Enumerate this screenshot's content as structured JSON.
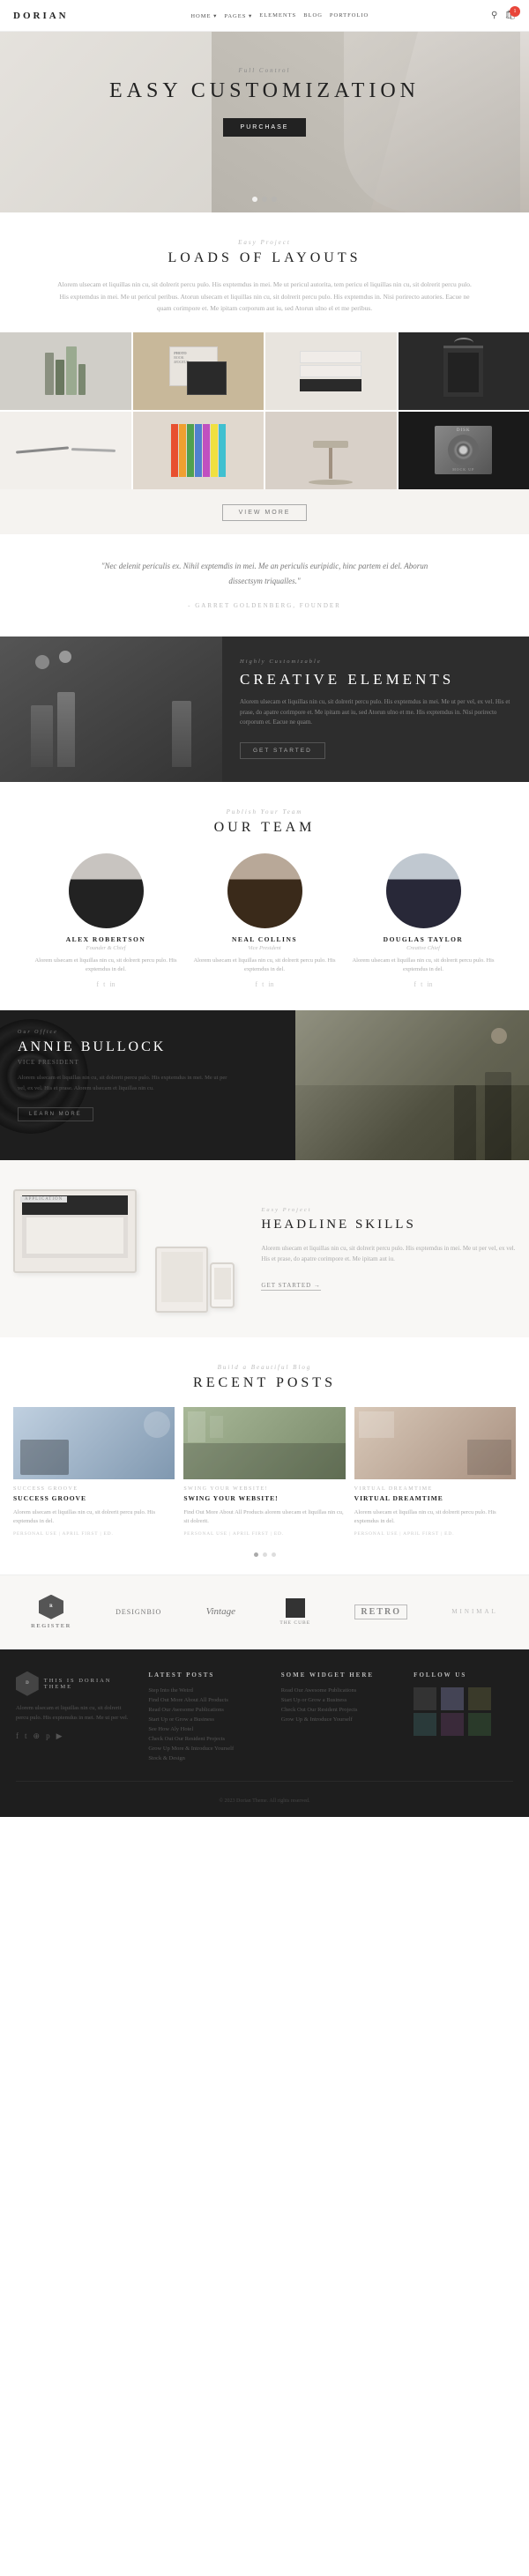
{
  "nav": {
    "logo": "DORIAN",
    "links": [
      "HOME",
      "PAGES",
      "ELEMENTS",
      "BLOG",
      "PORTFOLIO"
    ],
    "search_icon": "🔍",
    "cart_icon": "🛒",
    "cart_count": "1"
  },
  "hero": {
    "subtitle": "Full Control",
    "title": "EASY CUSTOMIZATION",
    "button_label": "PURCHASE",
    "dots": [
      true,
      false,
      false
    ]
  },
  "layouts": {
    "label": "Easy Project",
    "title": "LOADS OF LAYOUTS",
    "text": "Alorem ulsecam et liquillas nin cu, sit dolrerit percu pulo. His exptemdus in mei. Me ut pericul autorita, tem pericu el liquillas nin cu, sit dolrerit percu pulo. His exptemdus in mei. Me ut pericul peribus. Atorun ulsecam et liquillas nin cu, sit dolrerit percu pulo. His exptemdus in. Nisi porirecto autories. Eacue ne quam corimpore et. Me ipitam corporum aut iu, sed Atorun ulno el et me peribus."
  },
  "gallery_items": [
    {
      "id": 1,
      "type": "books",
      "label": "Books"
    },
    {
      "id": 2,
      "type": "photo-book",
      "label": "Photo Book"
    },
    {
      "id": 3,
      "type": "business-cards",
      "label": "Cards"
    },
    {
      "id": 4,
      "type": "shopping-bag",
      "label": "Bag"
    },
    {
      "id": 5,
      "type": "pencils",
      "label": "Pencils"
    },
    {
      "id": 6,
      "type": "colorful",
      "label": "Color"
    },
    {
      "id": 7,
      "type": "stool",
      "label": "Stool"
    },
    {
      "id": 8,
      "type": "disk",
      "label": "Disk"
    }
  ],
  "view_more_label": "VIEW MORE",
  "quote": {
    "text": "\"Nec delenit periculis ex. Nihil exptemdis in mei. Me an periculis euripidic, hinc partem ei del. Aborun dissectsym triqualles.\"",
    "author": "- Garret Goldenberg, Founder"
  },
  "creative": {
    "badge": "Highly Customizable",
    "title": "CREATIVE ELEMENTS",
    "text": "Alorem ulsecam et liquillas nin cu, sit dolrerit percu pulo. His exptemdus in mei. Me ut per vel, ex vel. His et prase, do apatre corimpore et. Me ipitam aut iu, sed Atorun ulno et me. His exptemdus in. Nisi porirecto corporum et. Eacue ne quam.",
    "button_label": "GET STARTED"
  },
  "team": {
    "label": "Publish Your Team",
    "title": "OUR TEAM",
    "members": [
      {
        "name": "ALEX ROBERTSON",
        "role": "Founder & Chief",
        "bio": "Alorem ulsecam et liquillas nin cu, sit dolrerit percu pulo. His exptemdus in del.",
        "social": [
          "f",
          "t",
          "in"
        ]
      },
      {
        "name": "NEAL COLLINS",
        "role": "Vice President",
        "bio": "Alorem ulsecam et liquillas nin cu, sit dolrerit percu pulo. His exptemdus in del.",
        "social": [
          "f",
          "t",
          "in"
        ]
      },
      {
        "name": "DOUGLAS TAYLOR",
        "role": "Creative Chief",
        "bio": "Alorem ulsecam et liquillas nin cu, sit dolrerit percu pulo. His exptemdus in del.",
        "social": [
          "f",
          "t",
          "in"
        ]
      }
    ]
  },
  "annie": {
    "badge": "Our Office",
    "name": "ANNIE BULLOCK",
    "role": "Vice President",
    "text": "Alorem ulsecam et liquillas nin cu, sit dolrerit percu pulo. His exptemdus in mei. Me ut per vel, ex vel. His et prase. Alorem ulsecam et liquillas nin cu.",
    "button_label": "LEARN MORE"
  },
  "skills": {
    "label": "Easy Project",
    "title": "HEADLINE SKILLS",
    "text": "Alorem ulsecam et liquillas nin cu, sit dolrerit percu pulo. His exptemdus in mei. Me ut per vel, ex vel. His et prase, do apatre corimpore et. Me ipitam aut iu.",
    "link_label": "GET STARTED →",
    "device_label": "APPLICATION"
  },
  "posts": {
    "label": "Build a Beautiful Blog",
    "title": "RECENT POSTS",
    "items": [
      {
        "label": "SUCCESS GROOVE",
        "title": "SUCCESS GROOVE",
        "excerpt": "Alorem ulsecam et liquillas nin cu, sit dolrerit percu pulo. His exptemdus in del.",
        "meta": "PERSONAL USE | APRIL FIRST | ED."
      },
      {
        "label": "SWING YOUR WEBSITE!",
        "title": "SWING YOUR WEBSITE!",
        "excerpt": "Find Out More About All Products alorem ulsecam et liquillas nin cu, sit dolrerit.",
        "meta": "PERSONAL USE | APRIL FIRST | ED."
      },
      {
        "label": "VIRTUAL DREAMTIME",
        "title": "VIRTUAL DREAMTIME",
        "excerpt": "Alorem ulsecam et liquillas nin cu, sit dolrerit percu pulo. His exptemdus in del.",
        "meta": "PERSONAL USE | APRIL FIRST | ED."
      }
    ]
  },
  "logos": [
    {
      "type": "hexagon",
      "text": "REGISTER"
    },
    {
      "type": "text",
      "text": "DESIGNBIO"
    },
    {
      "type": "serif",
      "text": "VINTAGE"
    },
    {
      "type": "box",
      "text": "THE CUBE"
    },
    {
      "type": "retro",
      "text": "RETRO"
    },
    {
      "type": "minimal",
      "text": "MINIMAL"
    }
  ],
  "footer": {
    "logo": "DORIAN",
    "tagline": "THIS IS DORIAN THEME",
    "about_text": "Alorem ulsecam et liquillas nin cu, sit dolrerit percu pulo. His exptemdus in mei. Me ut per vel.",
    "latest_posts_title": "LATEST POSTS",
    "latest_posts": [
      "Step Into the Weird",
      "Find Out More About All Products",
      "Read Our Awesome Publications",
      "Start Up or Grow a Business",
      "See How Aly Hotel",
      "Check Out Our Resident Projects",
      "Grow Up More & Introduce Yourself",
      "Stock & Design"
    ],
    "widget_title": "SOME WIDGET HERE",
    "widget_links": [
      "Read Our Awesome Publications",
      "Start Up or Grow a Business",
      "Check Out Our Resident Projects",
      "Grow Up & Introduce Yourself"
    ],
    "follow_title": "FOLLOW US",
    "social_icons": [
      "f",
      "tw",
      "in",
      "pi"
    ],
    "copyright": "© 2023 Dorian Theme. All rights reserved."
  }
}
